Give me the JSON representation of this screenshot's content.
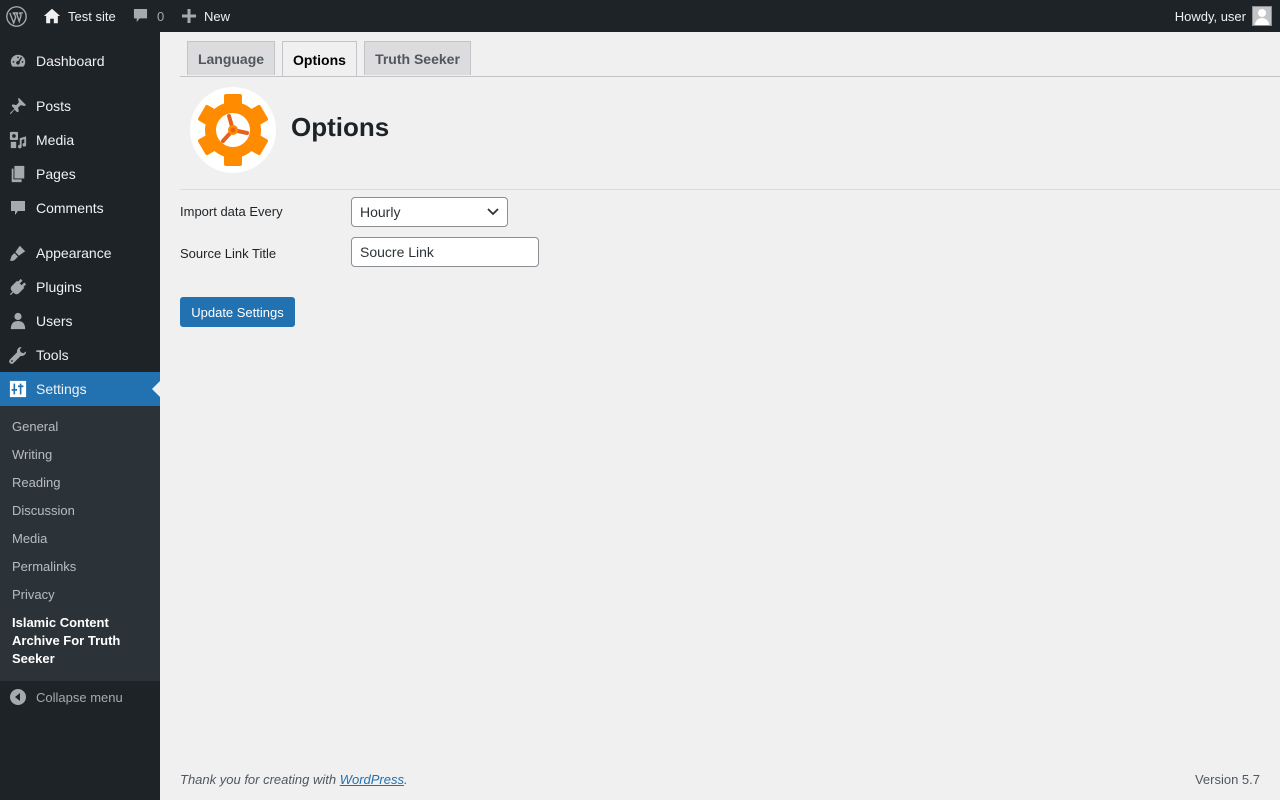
{
  "admin_bar": {
    "site_name": "Test site",
    "comments_count": "0",
    "new_label": "New",
    "howdy": "Howdy, user",
    "icons": [
      "wordpress-logo-icon",
      "home-icon",
      "comment-icon",
      "plus-icon",
      "avatar"
    ]
  },
  "sidebar": {
    "items": [
      {
        "label": "Dashboard",
        "icon": "dashboard-icon"
      },
      {
        "label": "Posts",
        "icon": "pushpin-icon"
      },
      {
        "label": "Media",
        "icon": "media-icon"
      },
      {
        "label": "Pages",
        "icon": "pages-icon"
      },
      {
        "label": "Comments",
        "icon": "comment-icon"
      },
      {
        "label": "Appearance",
        "icon": "paintbrush-icon"
      },
      {
        "label": "Plugins",
        "icon": "plugin-icon"
      },
      {
        "label": "Users",
        "icon": "user-icon"
      },
      {
        "label": "Tools",
        "icon": "wrench-icon"
      },
      {
        "label": "Settings",
        "icon": "settings-icon",
        "current": true
      }
    ],
    "submenu": [
      "General",
      "Writing",
      "Reading",
      "Discussion",
      "Media",
      "Permalinks",
      "Privacy",
      "Islamic Content Archive For Truth Seeker"
    ],
    "collapse_label": "Collapse menu"
  },
  "tabs": [
    {
      "label": "Language",
      "active": false
    },
    {
      "label": "Options",
      "active": true
    },
    {
      "label": "Truth Seeker",
      "active": false
    }
  ],
  "page": {
    "title": "Options",
    "logo_icon": "gear-icon"
  },
  "form": {
    "import_label": "Import data Every",
    "import_value": "Hourly",
    "source_label": "Source Link Title",
    "source_value": "Soucre Link",
    "submit_label": "Update Settings"
  },
  "footer": {
    "thanks_prefix": "Thank you for creating with ",
    "thanks_link": "WordPress",
    "thanks_suffix": ".",
    "version": "Version 5.7"
  },
  "colors": {
    "adminbar_bg": "#1d2327",
    "accent": "#2271b1",
    "submenu_bg": "#2c3338",
    "gear_orange": "#ff8c00",
    "gear_spokes": "#e8601c"
  }
}
